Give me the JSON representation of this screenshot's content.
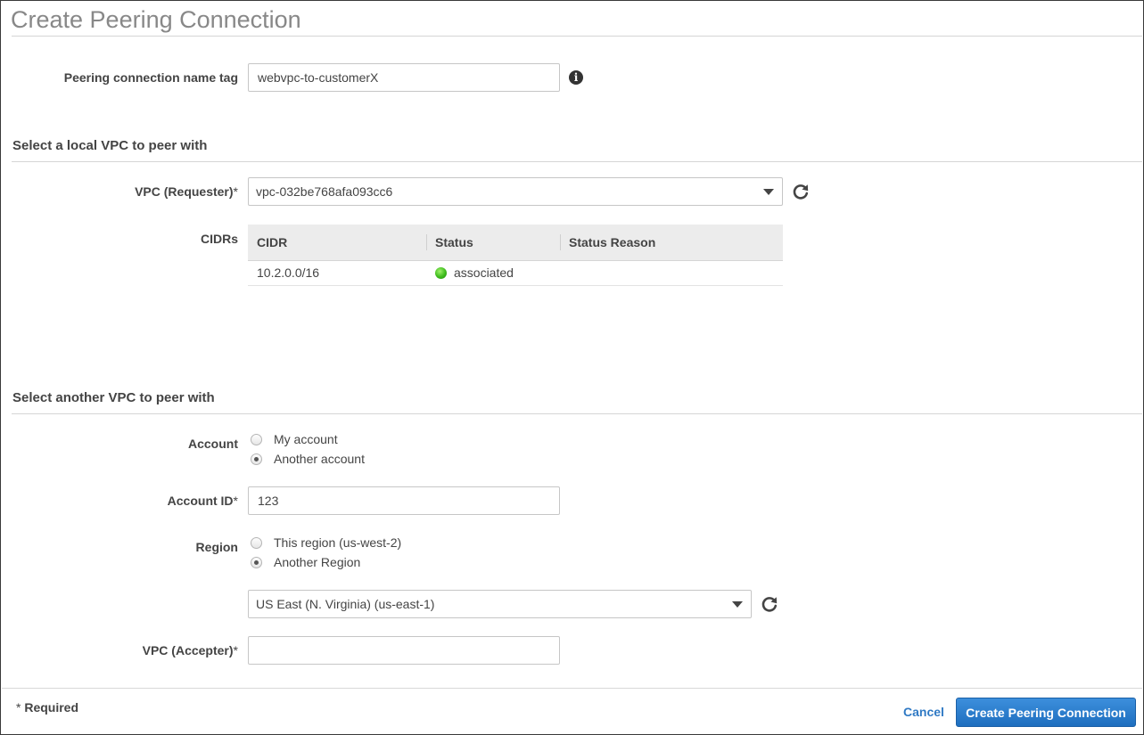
{
  "page": {
    "title": "Create Peering Connection"
  },
  "name_tag": {
    "label": "Peering connection name tag",
    "value": "webvpc-to-customerX"
  },
  "local_section": {
    "title": "Select a local VPC to peer with",
    "vpc_label": "VPC (Requester)",
    "vpc_value": "vpc-032be768afa093cc6",
    "cidrs_label": "CIDRs",
    "table": {
      "headers": [
        "CIDR",
        "Status",
        "Status Reason"
      ],
      "rows": [
        {
          "cidr": "10.2.0.0/16",
          "status": "associated",
          "reason": ""
        }
      ]
    }
  },
  "peer_section": {
    "title": "Select another VPC to peer with",
    "account_label": "Account",
    "account_options": [
      "My account",
      "Another account"
    ],
    "account_selected": "Another account",
    "account_id_label": "Account ID",
    "account_id_value": "123",
    "region_label": "Region",
    "region_options": [
      "This region (us-west-2)",
      "Another Region"
    ],
    "region_selected": "Another Region",
    "region_value": "US East (N. Virginia) (us-east-1)",
    "accepter_label": "VPC (Accepter)",
    "accepter_value": ""
  },
  "required_star": "*",
  "footer": {
    "required_note": "Required",
    "cancel": "Cancel",
    "submit": "Create Peering Connection"
  },
  "icons": {
    "info": "info-icon",
    "refresh": "refresh-icon",
    "caret": "chevron-down-icon"
  },
  "colors": {
    "primary": "#1e6ebf",
    "link": "#2f79c4",
    "status_ok": "#3dbb1c"
  }
}
